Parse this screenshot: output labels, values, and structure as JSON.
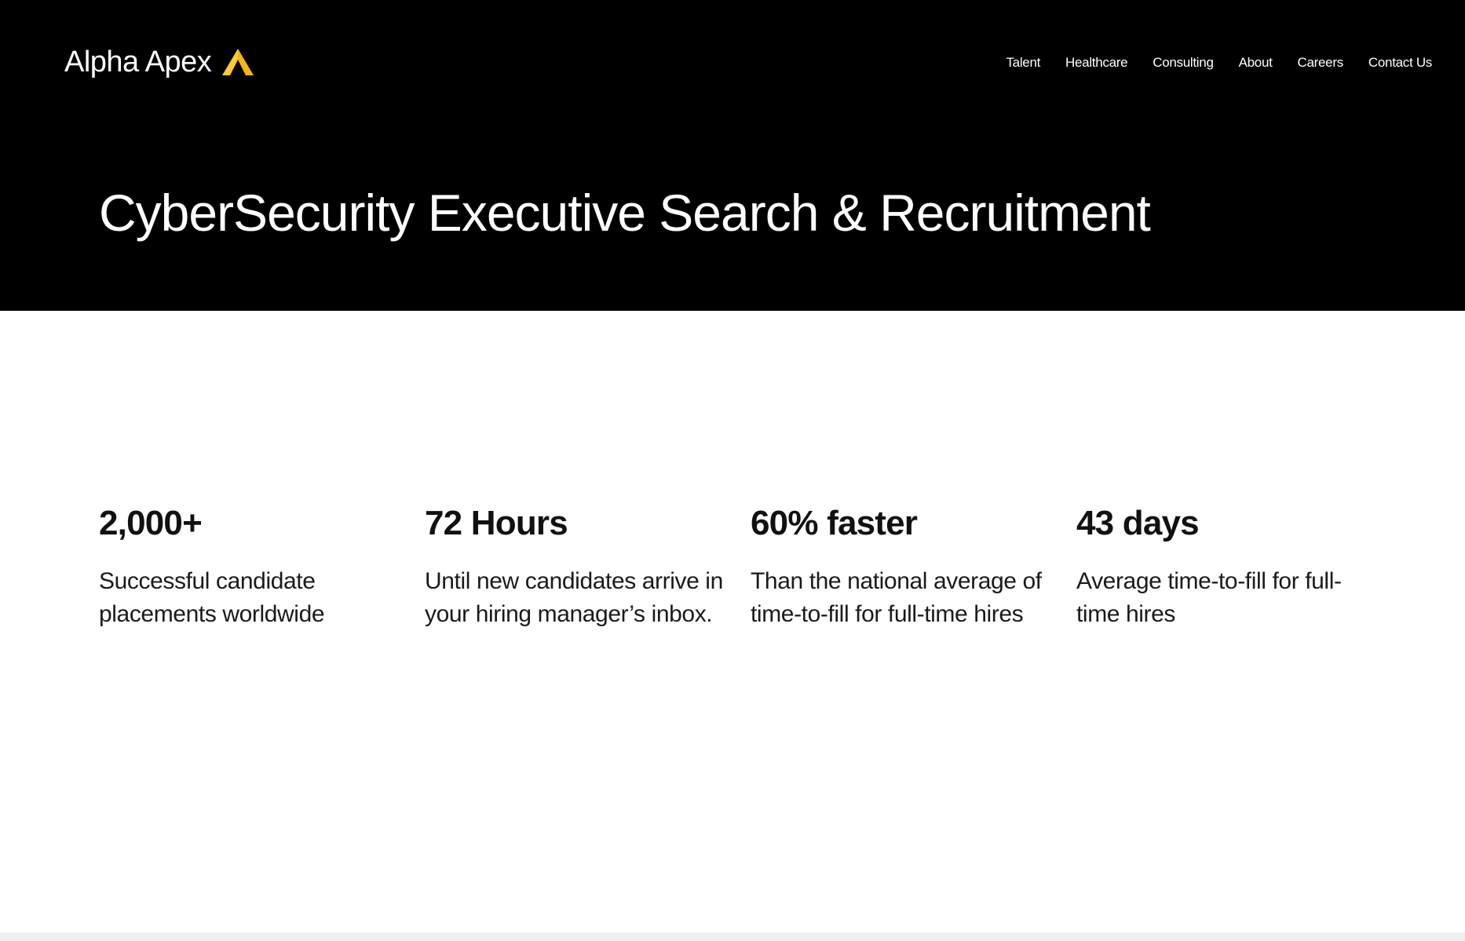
{
  "brand": {
    "name": "Alpha Apex",
    "logo_icon": "apex-triangle-icon",
    "accent_color": "#F5B519"
  },
  "nav": {
    "items": [
      {
        "label": "Talent"
      },
      {
        "label": "Healthcare"
      },
      {
        "label": "Consulting"
      },
      {
        "label": "About"
      },
      {
        "label": "Careers"
      },
      {
        "label": "Contact Us"
      }
    ]
  },
  "hero": {
    "title": "CyberSecurity Executive Search & Recruitment",
    "background_color": "#000000"
  },
  "stats": [
    {
      "value": "2,000+",
      "description": "Successful candidate placements worldwide"
    },
    {
      "value": "72 Hours",
      "description": "Until new candidates arrive in your hiring manager’s inbox."
    },
    {
      "value": "60% faster",
      "description": "Than the national average of time-to-fill for full-time hires"
    },
    {
      "value": "43 days",
      "description": "Average time-to-fill for full-time hires"
    }
  ]
}
